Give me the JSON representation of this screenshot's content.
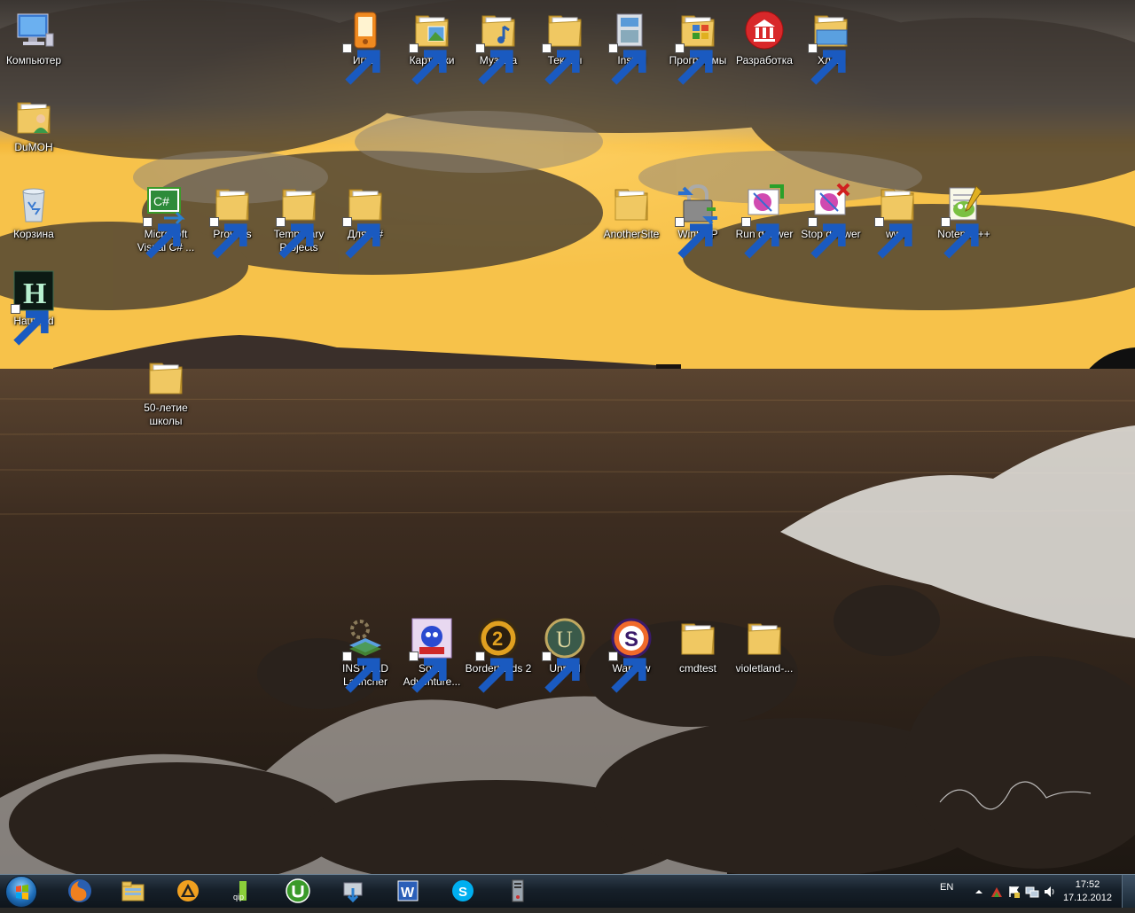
{
  "desktop": {
    "icons": [
      {
        "label": "Компьютер",
        "type": "computer",
        "shortcut": false
      },
      {
        "label": "DuMOH",
        "type": "user-folder",
        "shortcut": false
      },
      {
        "label": "Корзина",
        "type": "recycle-bin",
        "shortcut": false
      },
      {
        "label": "Haunted",
        "type": "haunted-app",
        "shortcut": true
      },
      {
        "label": "50-летие школы",
        "type": "folder",
        "shortcut": false
      },
      {
        "label": "Microsoft Visual C# ...",
        "type": "visual-csharp",
        "shortcut": true
      },
      {
        "label": "Projects",
        "type": "folder",
        "shortcut": true
      },
      {
        "label": "Temporary Projects",
        "type": "folder",
        "shortcut": true
      },
      {
        "label": "Для C#",
        "type": "folder",
        "shortcut": true
      },
      {
        "label": "Игры",
        "type": "games-app",
        "shortcut": true
      },
      {
        "label": "Картинки",
        "type": "pictures-folder",
        "shortcut": true
      },
      {
        "label": "Музыка",
        "type": "music-folder",
        "shortcut": true
      },
      {
        "label": "Тексты",
        "type": "folder",
        "shortcut": true
      },
      {
        "label": "Install",
        "type": "install-app",
        "shortcut": true
      },
      {
        "label": "Программы",
        "type": "programs-folder",
        "shortcut": true
      },
      {
        "label": "Разработка",
        "type": "dev-app",
        "shortcut": false
      },
      {
        "label": "Хлам",
        "type": "junk-folder",
        "shortcut": true
      },
      {
        "label": "AnotherSite",
        "type": "folder",
        "shortcut": false
      },
      {
        "label": "WinSCP",
        "type": "winscp",
        "shortcut": true
      },
      {
        "label": "Run denwer",
        "type": "run-denwer",
        "shortcut": true
      },
      {
        "label": "Stop denwer",
        "type": "stop-denwer",
        "shortcut": true
      },
      {
        "label": "www",
        "type": "folder",
        "shortcut": true
      },
      {
        "label": "Notepad++",
        "type": "notepadpp",
        "shortcut": true
      },
      {
        "label": "INSTEAD Launcher",
        "type": "instead",
        "shortcut": true
      },
      {
        "label": "Sonic Adventure...",
        "type": "sonic",
        "shortcut": true
      },
      {
        "label": "Borderlands 2",
        "type": "borderlands",
        "shortcut": true
      },
      {
        "label": "Unreal",
        "type": "unreal",
        "shortcut": true
      },
      {
        "label": "Warsow",
        "type": "warsow",
        "shortcut": true
      },
      {
        "label": "cmdtest",
        "type": "folder",
        "shortcut": false
      },
      {
        "label": "violetland-...",
        "type": "folder",
        "shortcut": false
      }
    ]
  },
  "taskbar": {
    "pinned": [
      {
        "name": "firefox-icon"
      },
      {
        "name": "explorer-icon"
      },
      {
        "name": "aimp-icon"
      },
      {
        "name": "qip-icon"
      },
      {
        "name": "utorrent-icon"
      },
      {
        "name": "downloader-icon"
      },
      {
        "name": "word-icon"
      },
      {
        "name": "skype-icon"
      },
      {
        "name": "server-icon"
      }
    ],
    "tray": {
      "language": "EN",
      "time": "17:52",
      "date": "17.12.2012"
    }
  },
  "colors": {
    "folder": "#e8c35a",
    "taskbar": "#16202a",
    "sky_glow": "#f5b632"
  }
}
